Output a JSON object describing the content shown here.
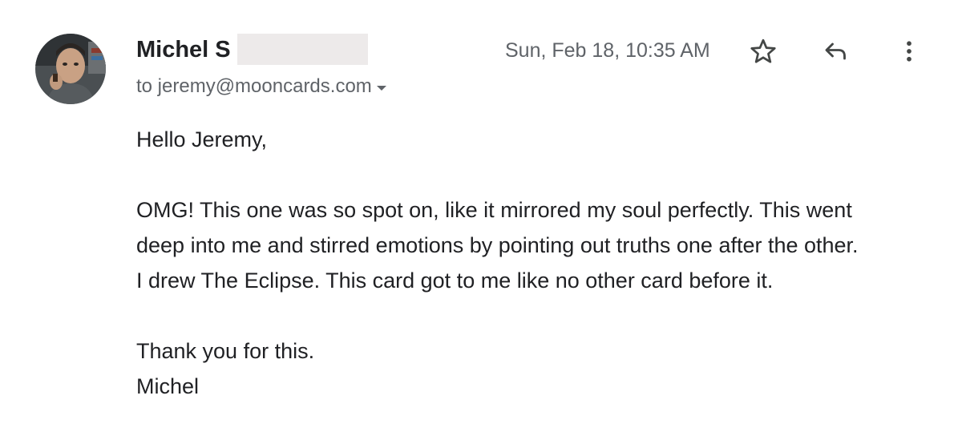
{
  "sender": {
    "name": "Michel S",
    "avatar_icon": "person-avatar"
  },
  "recipient_line": "to jeremy@mooncards.com",
  "timestamp": "Sun, Feb 18, 10:35 AM",
  "actions": {
    "star_icon": "star-icon",
    "reply_icon": "reply-icon",
    "more_icon": "more-vert-icon"
  },
  "body": {
    "greeting": "Hello Jeremy,",
    "paragraph": [
      "OMG! This one was so spot on, like it mirrored my soul perfectly. This went",
      "deep into me and stirred emotions by pointing out truths one after the other.",
      "I drew The Eclipse. This card got to me like no other card before it."
    ],
    "closing": "Thank you for this.",
    "signature": "Michel"
  },
  "colors": {
    "text_primary": "#202124",
    "text_secondary": "#5f6368",
    "redaction": "#edeaea"
  }
}
